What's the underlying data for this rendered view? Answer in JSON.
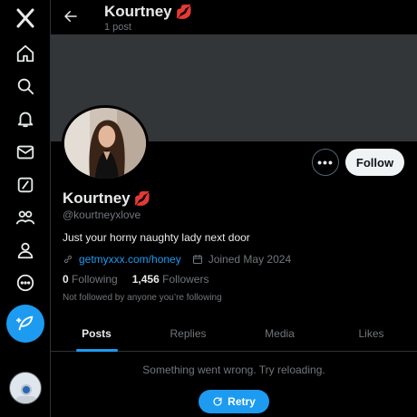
{
  "nav": {
    "logo_icon": "x-logo-icon",
    "items": [
      {
        "icon": "home-icon"
      },
      {
        "icon": "search-icon"
      },
      {
        "icon": "notifications-bell-icon"
      },
      {
        "icon": "messages-envelope-icon"
      },
      {
        "icon": "grok-slash-icon"
      },
      {
        "icon": "communities-icon"
      },
      {
        "icon": "profile-person-icon"
      },
      {
        "icon": "more-circle-icon"
      }
    ],
    "post_button_icon": "compose-feather-icon"
  },
  "header": {
    "name": "Kourtney",
    "emoji": "💋",
    "post_count": "1 post"
  },
  "profile": {
    "name": "Kourtney",
    "emoji": "💋",
    "handle": "@kourtneyxlove",
    "bio": "Just your horny naughty lady next door",
    "link": "getmyxxx.com/honey",
    "joined": "Joined May 2024",
    "following_count": "0",
    "following_label": "Following",
    "followers_count": "1,456",
    "followers_label": "Followers",
    "followed_note": "Not followed by anyone you’re following"
  },
  "actions": {
    "more_label": "•••",
    "follow_label": "Follow"
  },
  "tabs": [
    {
      "label": "Posts",
      "active": true
    },
    {
      "label": "Replies",
      "active": false
    },
    {
      "label": "Media",
      "active": false
    },
    {
      "label": "Likes",
      "active": false
    }
  ],
  "feed": {
    "error_message": "Something went wrong. Try reloading.",
    "retry_label": "Retry"
  },
  "colors": {
    "accent": "#1d9bf0",
    "background": "#000000",
    "banner": "#333639",
    "muted_text": "#71767b"
  }
}
